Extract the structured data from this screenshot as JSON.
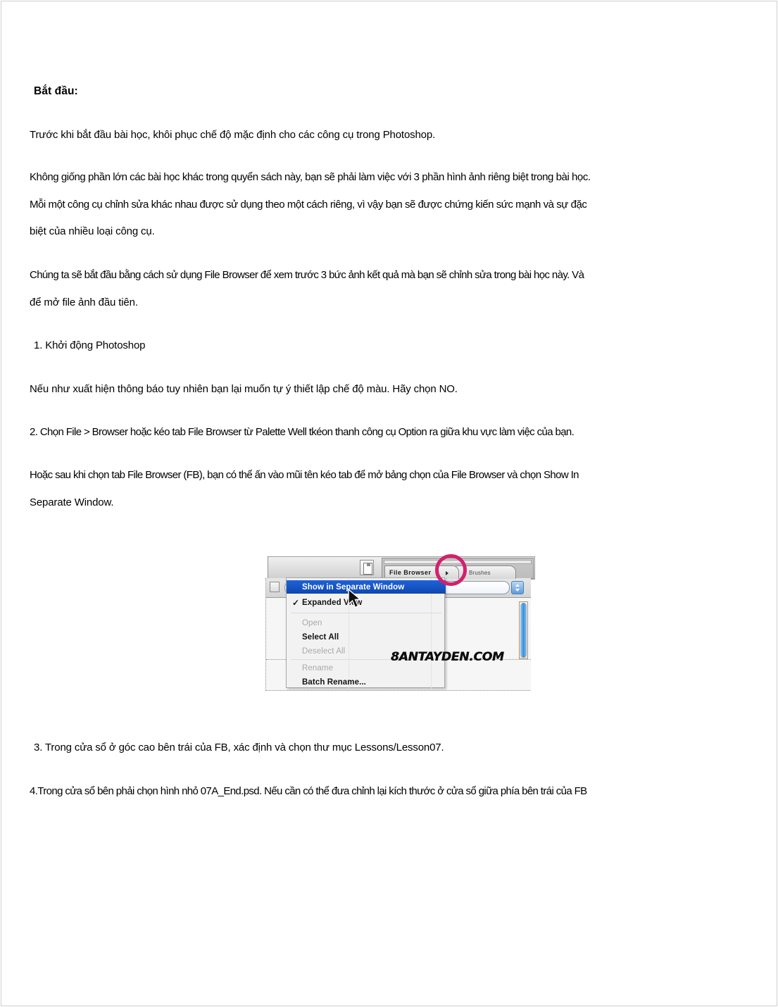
{
  "document": {
    "heading": "Bắt đầu:",
    "paragraphs": [
      "Trước khi bắt đầu bài học, khôi phục chế độ mặc định cho các công cụ trong Photoshop.",
      "Không giống phần lớn các bài học khác trong quyển sách này, bạn sẽ phải làm việc với 3 phần hình ảnh riêng biệt trong bài học.",
      "Mỗi một công cụ chỉnh sửa khác nhau được sử dụng theo một cách riêng, vì vậy bạn sẽ được chứng kiến sức mạnh và sự đặc",
      "biệt của nhiều loại công cụ.",
      "Chúng ta sẽ bắt đầu bằng cách sử dụng File Browser để xem trước 3 bức ảnh kết quả mà bạn sẽ chỉnh sửa trong bài học này. Và",
      "để mở file ảnh đầu tiên.",
      "1. Khởi động Photoshop",
      "Nếu như xuất hiện thông báo tuy nhiên bạn lại muốn tự ý thiết lập chế độ  màu. Hãy chọn NO.",
      "2. Chọn File > Browser hoặc kéo tab File Browser từ Palette Well tkéon thanh công cụ Option ra giữa khu vực làm việc của bạn.",
      "Hoặc sau khi chọn tab File Browser (FB), bạn có thể ấn vào mũi tên kéo tab để mở bảng chọn của File Browser và chọn Show In",
      "Separate Window.",
      "3. Trong cửa sổ ở góc cao bên trái của FB, xác định và chọn thư mục Lessons/Lesson07.",
      "4.Trong cửa sổ bên phải chọn hình nhỏ 07A_End.psd. Nếu cần có thể đưa chỉnh lại kích thước ở cửa sổ giữa phía bên trái của FB"
    ]
  },
  "figure": {
    "tabs": {
      "file_browser": "File Browser",
      "brushes": "Brushes"
    },
    "menu": {
      "items": [
        {
          "label": "Show in Separate Window",
          "state": "selected",
          "checked": false
        },
        {
          "label": "Expanded View",
          "state": "normal",
          "checked": true
        },
        {
          "label": "Open",
          "state": "disabled",
          "checked": false
        },
        {
          "label": "Select All",
          "state": "normal",
          "checked": false
        },
        {
          "label": "Deselect All",
          "state": "disabled",
          "checked": false
        },
        {
          "label": "Rename",
          "state": "disabled",
          "checked": false
        },
        {
          "label": "Batch Rename...",
          "state": "normal",
          "checked": false
        }
      ],
      "check_glyph": "✓"
    },
    "watermark": "8ANTAYDEN.COM",
    "highlight_color": "#d3206d",
    "selection_color": "#1f63d8"
  }
}
